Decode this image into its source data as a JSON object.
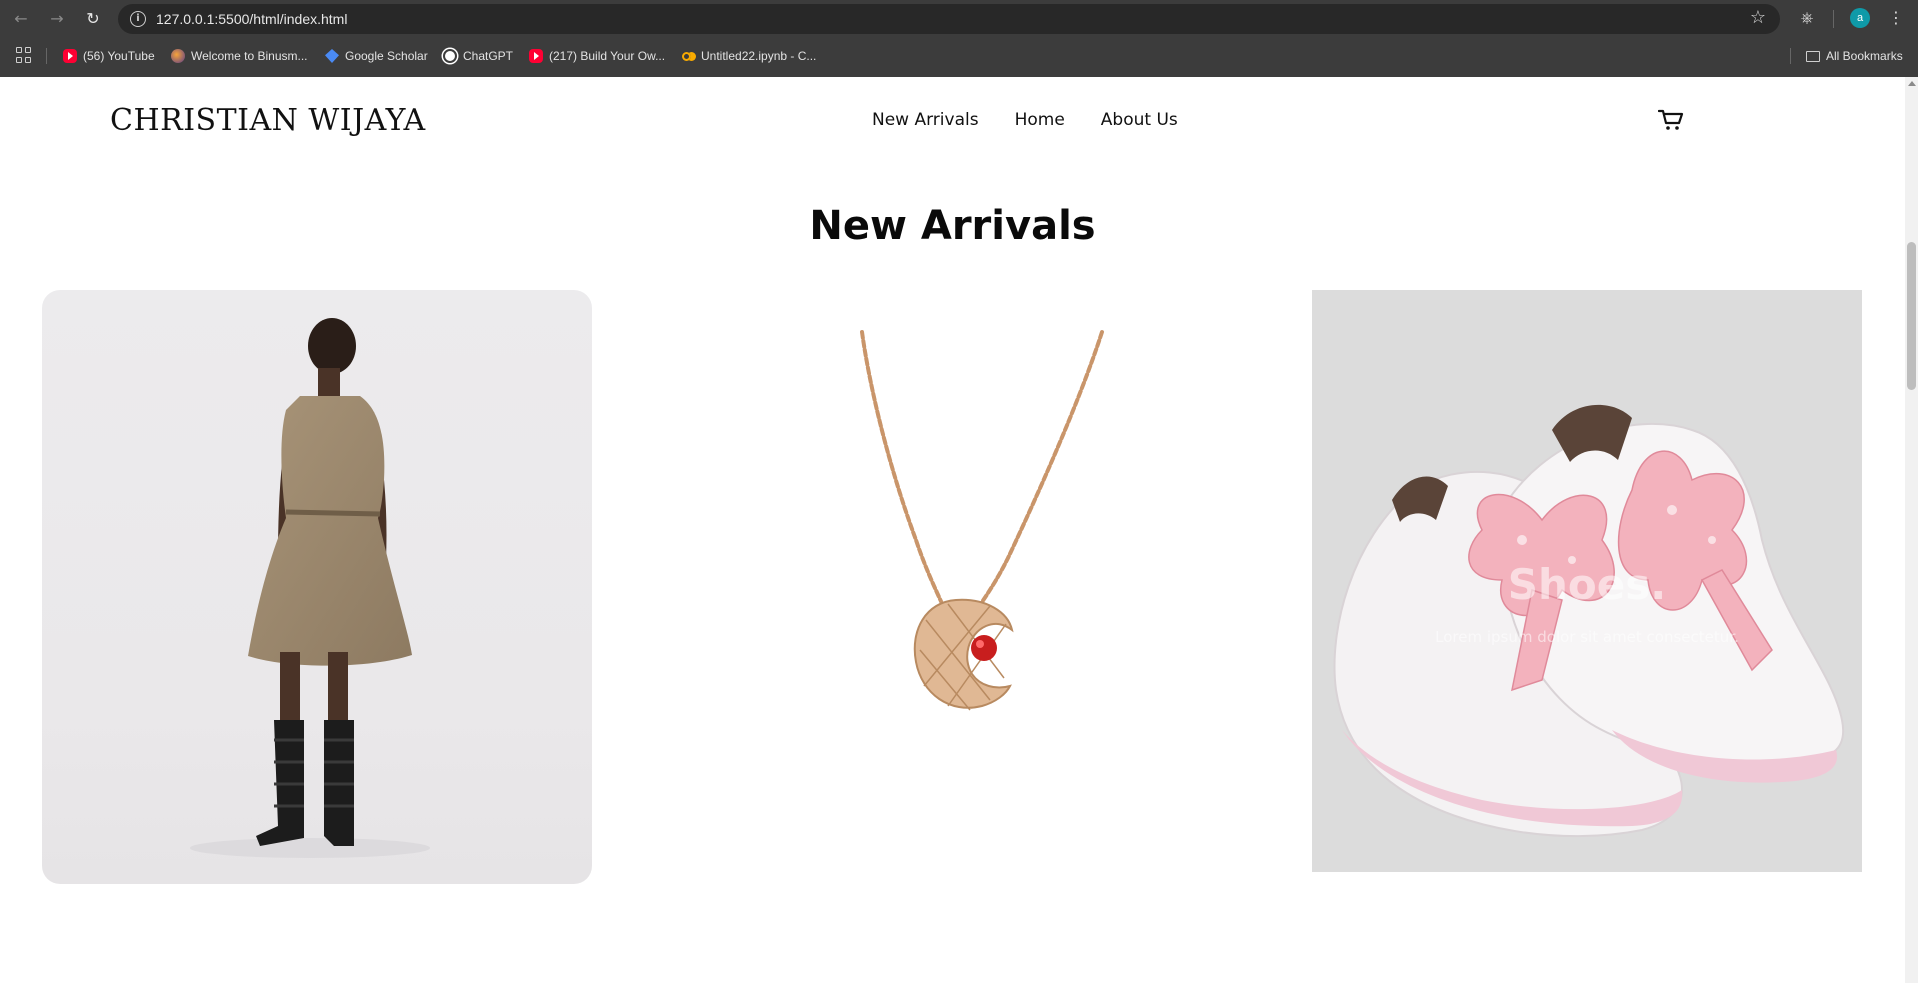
{
  "browser": {
    "url": "127.0.0.1:5500/html/index.html",
    "profile_initial": "a",
    "bookmarks": [
      {
        "label": "(56) YouTube",
        "icon": "youtube-icon"
      },
      {
        "label": "Welcome to Binusm...",
        "icon": "binusmaya-icon"
      },
      {
        "label": "Google Scholar",
        "icon": "google-scholar-icon"
      },
      {
        "label": "ChatGPT",
        "icon": "chatgpt-icon"
      },
      {
        "label": "(217) Build Your Ow...",
        "icon": "youtube-icon"
      },
      {
        "label": "Untitled22.ipynb - C...",
        "icon": "colab-icon"
      }
    ],
    "all_bookmarks_label": "All Bookmarks"
  },
  "site": {
    "logo": "CHRISTIAN WIJAYA",
    "nav": [
      {
        "label": "New Arrivals"
      },
      {
        "label": "Home"
      },
      {
        "label": "About Us"
      }
    ],
    "cart_icon": "shopping-cart-icon"
  },
  "section": {
    "title": "New Arrivals"
  },
  "products": [
    {
      "image": "woman-in-printed-dress-with-gladiator-boots"
    },
    {
      "image": "gold-pendant-necklace-with-red-stone"
    },
    {
      "image": "white-pink-sneakers-with-scarf-laces",
      "overlay_title": "Shoes.",
      "overlay_text": "Lorem ipsum dolor sit amet consectetur."
    }
  ],
  "colors": {
    "chrome_bg": "#3c3c3c",
    "page_bg": "#ffffff",
    "text": "#111111"
  }
}
